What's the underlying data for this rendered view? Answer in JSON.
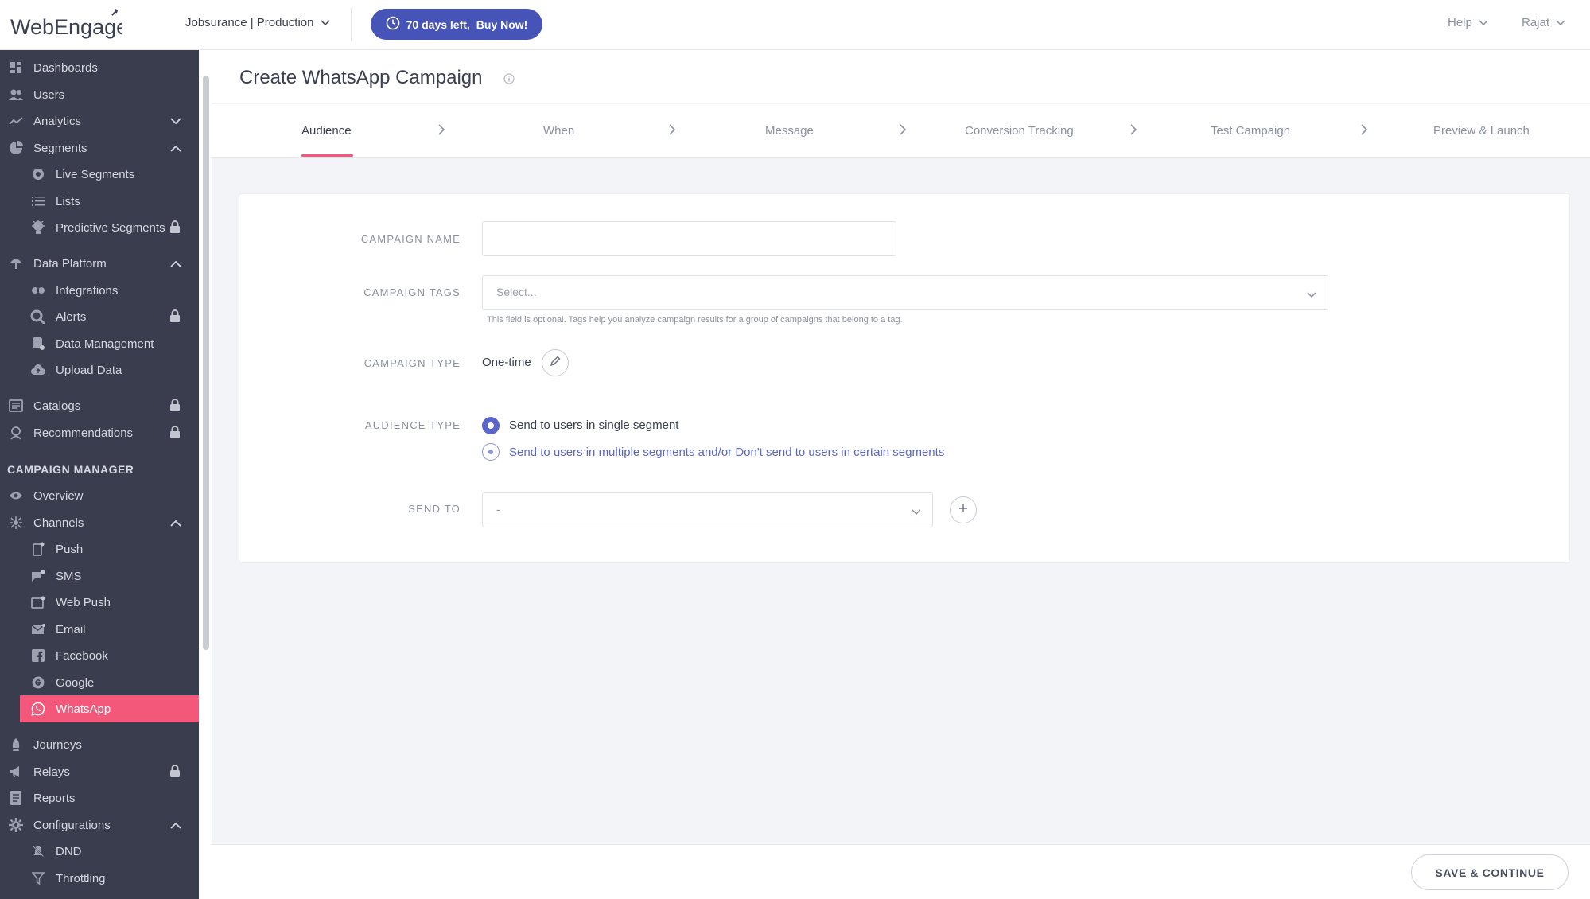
{
  "header": {
    "logo_text": "WebEngage",
    "project": "Jobsurance | Production",
    "trial_days": "70 days left,",
    "trial_cta": "Buy Now!",
    "help": "Help",
    "user": "Rajat"
  },
  "sidebar": {
    "items": [
      {
        "label": "Dashboards",
        "icon": "dashboard-icon"
      },
      {
        "label": "Users",
        "icon": "users-icon"
      },
      {
        "label": "Analytics",
        "icon": "analytics-icon"
      },
      {
        "label": "Segments",
        "icon": "segments-icon"
      },
      {
        "label": "Live Segments",
        "icon": "live-segments-icon"
      },
      {
        "label": "Lists",
        "icon": "lists-icon"
      },
      {
        "label": "Predictive Segments",
        "icon": "predictive-icon"
      },
      {
        "label": "Data Platform",
        "icon": "data-platform-icon"
      },
      {
        "label": "Integrations",
        "icon": "integrations-icon"
      },
      {
        "label": "Alerts",
        "icon": "alerts-icon"
      },
      {
        "label": "Data Management",
        "icon": "data-management-icon"
      },
      {
        "label": "Upload Data",
        "icon": "upload-icon"
      },
      {
        "label": "Catalogs",
        "icon": "catalogs-icon"
      },
      {
        "label": "Recommendations",
        "icon": "recommendations-icon"
      },
      {
        "label": "Overview",
        "icon": "eye-icon"
      },
      {
        "label": "Channels",
        "icon": "channels-icon"
      },
      {
        "label": "Push",
        "icon": "push-icon"
      },
      {
        "label": "SMS",
        "icon": "sms-icon"
      },
      {
        "label": "Web Push",
        "icon": "web-push-icon"
      },
      {
        "label": "Email",
        "icon": "email-icon"
      },
      {
        "label": "Facebook",
        "icon": "facebook-icon"
      },
      {
        "label": "Google",
        "icon": "google-icon"
      },
      {
        "label": "WhatsApp",
        "icon": "whatsapp-icon"
      },
      {
        "label": "Journeys",
        "icon": "journeys-icon"
      },
      {
        "label": "Relays",
        "icon": "relays-icon"
      },
      {
        "label": "Reports",
        "icon": "reports-icon"
      },
      {
        "label": "Configurations",
        "icon": "configurations-icon"
      },
      {
        "label": "DND",
        "icon": "dnd-icon"
      },
      {
        "label": "Throttling",
        "icon": "throttling-icon"
      }
    ],
    "section_campaign_manager": "CAMPAIGN MANAGER"
  },
  "main": {
    "title": "Create WhatsApp Campaign",
    "steps": [
      "Audience",
      "When",
      "Message",
      "Conversion Tracking",
      "Test Campaign",
      "Preview & Launch"
    ],
    "active_step": "Audience",
    "form": {
      "campaign_name_label": "CAMPAIGN NAME",
      "campaign_name_value": "",
      "campaign_tags_label": "CAMPAIGN TAGS",
      "campaign_tags_placeholder": "Select...",
      "campaign_tags_hint": "This field is optional. Tags help you analyze campaign results for a group of campaigns that belong to a tag.",
      "campaign_type_label": "CAMPAIGN TYPE",
      "campaign_type_value": "One-time",
      "audience_type_label": "AUDIENCE TYPE",
      "audience_option_single": "Send to users in single segment",
      "audience_option_multiple": "Send to users in multiple segments and/or Don't send to users in certain segments",
      "send_to_label": "SEND TO",
      "send_to_value": "-"
    },
    "save_button": "SAVE & CONTINUE"
  },
  "colors": {
    "brand_accent": "#f3587b",
    "primary": "#4654b8",
    "sidebar_bg": "#3a3d4d"
  }
}
